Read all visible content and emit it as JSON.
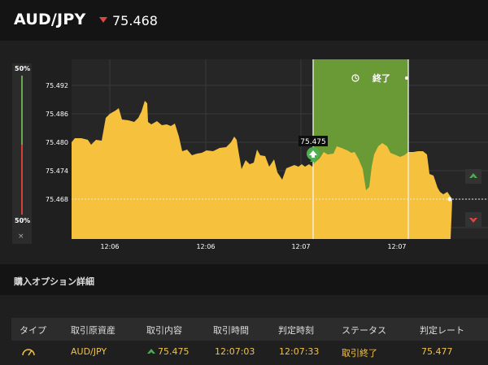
{
  "header": {
    "pair": "AUD/JPY",
    "rate": "75.468",
    "rate_direction": "down"
  },
  "meter": {
    "top_label": "50%",
    "bottom_label": "50%",
    "close_label": "×"
  },
  "chart_data": {
    "type": "area",
    "y_ticks": [
      "75.492",
      "75.486",
      "75.480",
      "75.474",
      "75.468"
    ],
    "x_ticks": [
      "12:06",
      "12:06",
      "12:07",
      "12:07"
    ],
    "current_rate": "75.468",
    "entry_rate": "75.475",
    "expiry_label": "終了",
    "colors": {
      "area": "#f6c13d",
      "window": "#6a9a36",
      "up": "#4caf50",
      "down": "#e04545"
    }
  },
  "details": {
    "title": "購入オプション詳細",
    "columns": [
      "タイプ",
      "取引原資産",
      "取引内容",
      "取引時間",
      "判定時刻",
      "ステータス",
      "判定レート"
    ],
    "row": {
      "asset": "AUD/JPY",
      "direction": "up",
      "trade_rate": "75.475",
      "trade_time": "12:07:03",
      "judge_time": "12:07:33",
      "status": "取引終了",
      "judge_rate": "75.477"
    }
  }
}
